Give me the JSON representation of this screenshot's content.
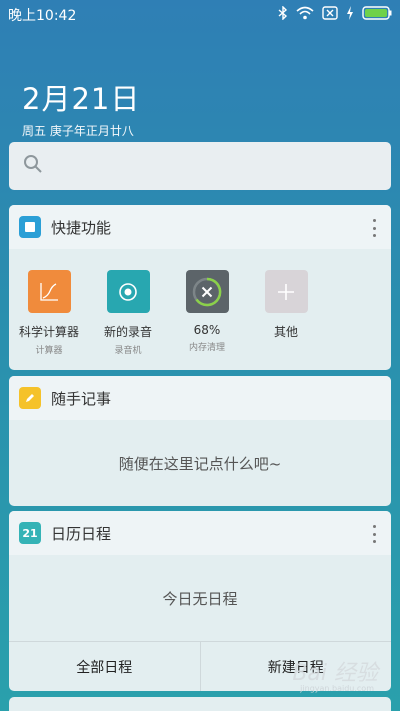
{
  "status_bar": {
    "time": "晚上10:42"
  },
  "date": {
    "main": "2月21日",
    "sub": "周五 庚子年正月廿八"
  },
  "search": {
    "placeholder": ""
  },
  "quick_functions": {
    "title": "快捷功能",
    "apps": [
      {
        "label": "科学计算器",
        "sub": "计算器",
        "icon": "calculator-chart-icon",
        "color": "#f08b3c"
      },
      {
        "label": "新的录音",
        "sub": "录音机",
        "icon": "record-icon",
        "color": "#28a7b0"
      },
      {
        "label": "68%",
        "sub": "内存清理",
        "icon": "memory-clean-icon",
        "color": "#5c6469"
      },
      {
        "label": "其他",
        "sub": "",
        "icon": "plus-icon",
        "color": "#d8d4d8"
      }
    ]
  },
  "notes": {
    "title": "随手记事",
    "placeholder": "随便在这里记点什么吧~"
  },
  "calendar": {
    "title": "日历日程",
    "icon_day": "21",
    "empty": "今日无日程",
    "btn_all": "全部日程",
    "btn_new": "新建日程"
  },
  "watermark": {
    "brand": "Bai 经验",
    "url": "jingyan.baidu.com"
  },
  "colors": {
    "quick_icon": "#2b9fd6",
    "notes_icon": "#f5c22a",
    "calendar_icon": "#34b3b6"
  }
}
